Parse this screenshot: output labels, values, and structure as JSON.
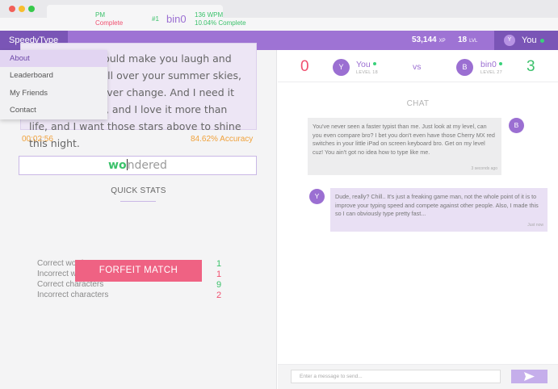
{
  "app": {
    "brand": "SpeedyType"
  },
  "nav": {
    "xp_value": "53,144",
    "xp_unit": "XP",
    "level_value": "18",
    "level_unit": "LVL",
    "user_initial": "Y",
    "user_name": "You"
  },
  "menu": {
    "items": [
      {
        "label": "About",
        "active": true
      },
      {
        "label": "Leaderboard"
      },
      {
        "label": "My Friends"
      },
      {
        "label": "Contact"
      }
    ]
  },
  "race": {
    "you": {
      "wpm_tail": "PM",
      "complete_tail": "Complete"
    },
    "opponent": {
      "rank": "#1",
      "name": "bin0",
      "wpm": "136 WPM",
      "complete": "10.04% Complete"
    },
    "passage_before": "",
    "passage_highlight": "ndered",
    "passage_after": " why I could make you laugh and cry? Eclipsing all over your summer skies, some things never change. And I need it more than love, and I love it more than life, and I want those stars above to shine this night.",
    "timer": "00:02:56",
    "accuracy": "84.62% Accuracy",
    "input_typed": "wo",
    "input_rest": "ndered"
  },
  "stats": {
    "title": "QUICK STATS",
    "rows": [
      {
        "label": "Correct words",
        "value": "1",
        "color": "#3bc16b"
      },
      {
        "label": "Incorrect words",
        "value": "1",
        "color": "#f04f6f"
      },
      {
        "label": "Correct characters",
        "value": "9",
        "color": "#3bc16b"
      },
      {
        "label": "Incorrect characters",
        "value": "2",
        "color": "#f04f6f"
      }
    ],
    "forfeit": "FORFEIT MATCH"
  },
  "scoreboard": {
    "left_score": "0",
    "right_score": "3",
    "vs": "vs",
    "you": {
      "initial": "Y",
      "name": "You",
      "level": "LEVEL 18"
    },
    "opponent": {
      "initial": "B",
      "name": "bin0",
      "level": "LEVEL 27"
    }
  },
  "chat": {
    "title": "CHAT",
    "messages": [
      {
        "initial": "B",
        "text": "You've never seen a faster typist than me. Just look at my level, can you even compare bro? I bet you don't even have those Cherry MX red switches in your little iPad on screen keyboard bro. Get on my level cuz! You ain't got no idea how to type like me.",
        "time": "3 seconds ago"
      },
      {
        "initial": "Y",
        "text": "Dude, really? Chill.. It's just a freaking game man, not the whole point of it is to improve your typing speed and compete against other people. Also, I made this so I can obviously type pretty fast...",
        "time": "Just now"
      }
    ],
    "placeholder": "Enter a message to send...",
    "send_icon": "send-icon"
  }
}
